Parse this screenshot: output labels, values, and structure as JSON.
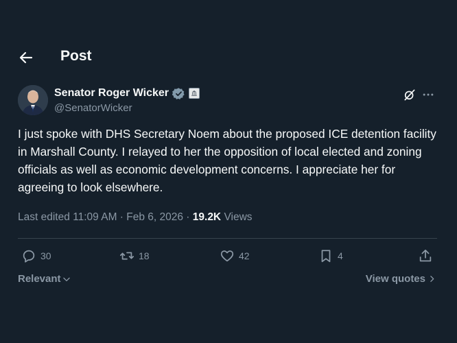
{
  "header": {
    "back_icon": "arrow-left-icon",
    "title": "Post"
  },
  "author": {
    "name": "Senator Roger Wicker",
    "handle": "@SenatorWicker",
    "verified_icon": "verified-badge-icon",
    "affiliation_icon": "government-badge-icon"
  },
  "post": {
    "text": "I just spoke with DHS Secretary Noem about the proposed ICE detention facility in Marshall County. I relayed to her the opposition of local elected and zoning officials as well as economic development concerns. I appreciate her for agreeing to look elsewhere.",
    "edited_label": "Last edited 11:09 AM · Feb 6, 2026 · ",
    "views_count": "19.2K",
    "views_label": " Views"
  },
  "actions": {
    "replies": "30",
    "reposts": "18",
    "likes": "42",
    "bookmarks": "4"
  },
  "footer": {
    "sort_label": "Relevant",
    "quotes_label": "View quotes"
  },
  "colors": {
    "background": "#15202b",
    "text": "#f7f9f9",
    "secondary": "#8b98a5",
    "verified": "#829aab",
    "divider": "#38444d"
  }
}
